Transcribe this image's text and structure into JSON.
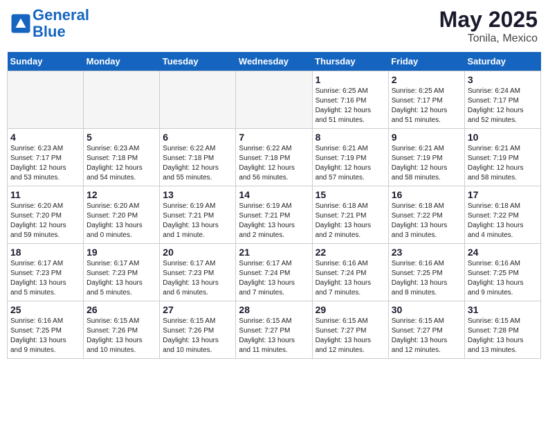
{
  "header": {
    "logo_line1": "General",
    "logo_line2": "Blue",
    "month_year": "May 2025",
    "location": "Tonila, Mexico"
  },
  "weekdays": [
    "Sunday",
    "Monday",
    "Tuesday",
    "Wednesday",
    "Thursday",
    "Friday",
    "Saturday"
  ],
  "weeks": [
    [
      {
        "day": "",
        "info": "",
        "empty": true
      },
      {
        "day": "",
        "info": "",
        "empty": true
      },
      {
        "day": "",
        "info": "",
        "empty": true
      },
      {
        "day": "",
        "info": "",
        "empty": true
      },
      {
        "day": "1",
        "info": "Sunrise: 6:25 AM\nSunset: 7:16 PM\nDaylight: 12 hours\nand 51 minutes.",
        "empty": false
      },
      {
        "day": "2",
        "info": "Sunrise: 6:25 AM\nSunset: 7:17 PM\nDaylight: 12 hours\nand 51 minutes.",
        "empty": false
      },
      {
        "day": "3",
        "info": "Sunrise: 6:24 AM\nSunset: 7:17 PM\nDaylight: 12 hours\nand 52 minutes.",
        "empty": false
      }
    ],
    [
      {
        "day": "4",
        "info": "Sunrise: 6:23 AM\nSunset: 7:17 PM\nDaylight: 12 hours\nand 53 minutes.",
        "empty": false
      },
      {
        "day": "5",
        "info": "Sunrise: 6:23 AM\nSunset: 7:18 PM\nDaylight: 12 hours\nand 54 minutes.",
        "empty": false
      },
      {
        "day": "6",
        "info": "Sunrise: 6:22 AM\nSunset: 7:18 PM\nDaylight: 12 hours\nand 55 minutes.",
        "empty": false
      },
      {
        "day": "7",
        "info": "Sunrise: 6:22 AM\nSunset: 7:18 PM\nDaylight: 12 hours\nand 56 minutes.",
        "empty": false
      },
      {
        "day": "8",
        "info": "Sunrise: 6:21 AM\nSunset: 7:19 PM\nDaylight: 12 hours\nand 57 minutes.",
        "empty": false
      },
      {
        "day": "9",
        "info": "Sunrise: 6:21 AM\nSunset: 7:19 PM\nDaylight: 12 hours\nand 58 minutes.",
        "empty": false
      },
      {
        "day": "10",
        "info": "Sunrise: 6:21 AM\nSunset: 7:19 PM\nDaylight: 12 hours\nand 58 minutes.",
        "empty": false
      }
    ],
    [
      {
        "day": "11",
        "info": "Sunrise: 6:20 AM\nSunset: 7:20 PM\nDaylight: 12 hours\nand 59 minutes.",
        "empty": false
      },
      {
        "day": "12",
        "info": "Sunrise: 6:20 AM\nSunset: 7:20 PM\nDaylight: 13 hours\nand 0 minutes.",
        "empty": false
      },
      {
        "day": "13",
        "info": "Sunrise: 6:19 AM\nSunset: 7:21 PM\nDaylight: 13 hours\nand 1 minute.",
        "empty": false
      },
      {
        "day": "14",
        "info": "Sunrise: 6:19 AM\nSunset: 7:21 PM\nDaylight: 13 hours\nand 2 minutes.",
        "empty": false
      },
      {
        "day": "15",
        "info": "Sunrise: 6:18 AM\nSunset: 7:21 PM\nDaylight: 13 hours\nand 2 minutes.",
        "empty": false
      },
      {
        "day": "16",
        "info": "Sunrise: 6:18 AM\nSunset: 7:22 PM\nDaylight: 13 hours\nand 3 minutes.",
        "empty": false
      },
      {
        "day": "17",
        "info": "Sunrise: 6:18 AM\nSunset: 7:22 PM\nDaylight: 13 hours\nand 4 minutes.",
        "empty": false
      }
    ],
    [
      {
        "day": "18",
        "info": "Sunrise: 6:17 AM\nSunset: 7:23 PM\nDaylight: 13 hours\nand 5 minutes.",
        "empty": false
      },
      {
        "day": "19",
        "info": "Sunrise: 6:17 AM\nSunset: 7:23 PM\nDaylight: 13 hours\nand 5 minutes.",
        "empty": false
      },
      {
        "day": "20",
        "info": "Sunrise: 6:17 AM\nSunset: 7:23 PM\nDaylight: 13 hours\nand 6 minutes.",
        "empty": false
      },
      {
        "day": "21",
        "info": "Sunrise: 6:17 AM\nSunset: 7:24 PM\nDaylight: 13 hours\nand 7 minutes.",
        "empty": false
      },
      {
        "day": "22",
        "info": "Sunrise: 6:16 AM\nSunset: 7:24 PM\nDaylight: 13 hours\nand 7 minutes.",
        "empty": false
      },
      {
        "day": "23",
        "info": "Sunrise: 6:16 AM\nSunset: 7:25 PM\nDaylight: 13 hours\nand 8 minutes.",
        "empty": false
      },
      {
        "day": "24",
        "info": "Sunrise: 6:16 AM\nSunset: 7:25 PM\nDaylight: 13 hours\nand 9 minutes.",
        "empty": false
      }
    ],
    [
      {
        "day": "25",
        "info": "Sunrise: 6:16 AM\nSunset: 7:25 PM\nDaylight: 13 hours\nand 9 minutes.",
        "empty": false
      },
      {
        "day": "26",
        "info": "Sunrise: 6:15 AM\nSunset: 7:26 PM\nDaylight: 13 hours\nand 10 minutes.",
        "empty": false
      },
      {
        "day": "27",
        "info": "Sunrise: 6:15 AM\nSunset: 7:26 PM\nDaylight: 13 hours\nand 10 minutes.",
        "empty": false
      },
      {
        "day": "28",
        "info": "Sunrise: 6:15 AM\nSunset: 7:27 PM\nDaylight: 13 hours\nand 11 minutes.",
        "empty": false
      },
      {
        "day": "29",
        "info": "Sunrise: 6:15 AM\nSunset: 7:27 PM\nDaylight: 13 hours\nand 12 minutes.",
        "empty": false
      },
      {
        "day": "30",
        "info": "Sunrise: 6:15 AM\nSunset: 7:27 PM\nDaylight: 13 hours\nand 12 minutes.",
        "empty": false
      },
      {
        "day": "31",
        "info": "Sunrise: 6:15 AM\nSunset: 7:28 PM\nDaylight: 13 hours\nand 13 minutes.",
        "empty": false
      }
    ]
  ]
}
